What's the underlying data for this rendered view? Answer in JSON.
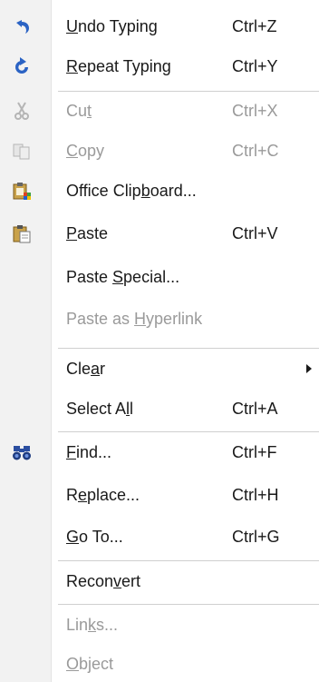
{
  "menu": {
    "items": [
      {
        "label_pre": "",
        "label_u": "U",
        "label_post": "ndo Typing",
        "shortcut": "Ctrl+Z",
        "icon": "undo-icon"
      },
      {
        "label_pre": "",
        "label_u": "R",
        "label_post": "epeat Typing",
        "shortcut": "Ctrl+Y",
        "icon": "repeat-icon"
      },
      {
        "label_pre": "Cu",
        "label_u": "t",
        "label_post": "",
        "shortcut": "Ctrl+X",
        "icon": "scissors-icon"
      },
      {
        "label_pre": "",
        "label_u": "C",
        "label_post": "opy",
        "shortcut": "Ctrl+C",
        "icon": "copy-icon"
      },
      {
        "label_pre": "Office Clip",
        "label_u": "b",
        "label_post": "oard...",
        "shortcut": "",
        "icon": "office-clipboard-icon"
      },
      {
        "label_pre": "",
        "label_u": "P",
        "label_post": "aste",
        "shortcut": "Ctrl+V",
        "icon": "paste-icon"
      },
      {
        "label_pre": "Paste ",
        "label_u": "S",
        "label_post": "pecial...",
        "shortcut": "",
        "icon": ""
      },
      {
        "label_pre": "Paste as ",
        "label_u": "H",
        "label_post": "yperlink",
        "shortcut": "",
        "icon": ""
      },
      {
        "label_pre": "Cle",
        "label_u": "a",
        "label_post": "r",
        "shortcut": "",
        "icon": ""
      },
      {
        "label_pre": "Select A",
        "label_u": "l",
        "label_post": "l",
        "shortcut": "Ctrl+A",
        "icon": ""
      },
      {
        "label_pre": "",
        "label_u": "F",
        "label_post": "ind...",
        "shortcut": "Ctrl+F",
        "icon": "find-binoculars-icon"
      },
      {
        "label_pre": "R",
        "label_u": "e",
        "label_post": "place...",
        "shortcut": "Ctrl+H",
        "icon": ""
      },
      {
        "label_pre": "",
        "label_u": "G",
        "label_post": "o To...",
        "shortcut": "Ctrl+G",
        "icon": ""
      },
      {
        "label_pre": "Recon",
        "label_u": "v",
        "label_post": "ert",
        "shortcut": "",
        "icon": ""
      },
      {
        "label_pre": "Lin",
        "label_u": "k",
        "label_post": "s...",
        "shortcut": "",
        "icon": ""
      },
      {
        "label_pre": "",
        "label_u": "O",
        "label_post": "bject",
        "shortcut": "",
        "icon": ""
      }
    ]
  },
  "colors": {
    "undo_blue": "#2b63c4",
    "disabled_text": "#9a9a9a",
    "gutter": "#f2f2f2",
    "separator": "#cfcfcf"
  }
}
